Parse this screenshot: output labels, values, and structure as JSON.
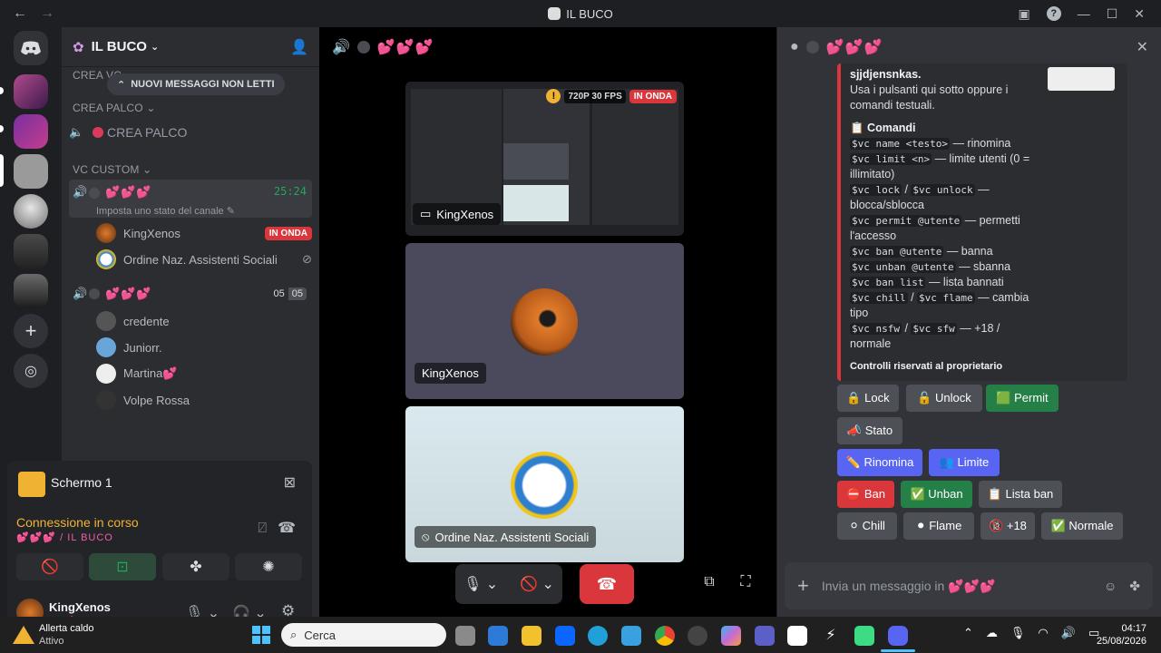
{
  "window": {
    "title": "IL BUCO"
  },
  "guild": {
    "name": "IL BUCO",
    "unread_pill": "NUOVI MESSAGGI NON LETTI",
    "cat_crea_vc": "CREA VC",
    "cat_crea_palco": "CREA PALCO",
    "crea_palco_channel": "CREA PALCO",
    "cat_vc_custom": "VC CUSTOM",
    "vc1": {
      "hearts": "💕💕💕",
      "timer": "25:24",
      "status_hint": "Imposta uno stato del canale"
    },
    "vc1_members": [
      {
        "name": "KingXenos",
        "badge": "IN ONDA"
      },
      {
        "name": "Ordine Naz. Assistenti Sociali"
      }
    ],
    "vc2": {
      "hearts": "💕💕💕",
      "count_a": "05",
      "count_b": "05"
    },
    "vc2_members": [
      {
        "name": "credente"
      },
      {
        "name": "Juniorr."
      },
      {
        "name": "Martina💕"
      },
      {
        "name": "Volpe Rossa"
      }
    ]
  },
  "voice_panel": {
    "screen_label": "Schermo 1",
    "connection": "Connessione in corso",
    "channel_path": "💕💕💕 / IL BUCO",
    "user": "KingXenos"
  },
  "stage": {
    "header_hearts": "💕💕💕",
    "stream_badge_fps": "720P 30 FPS",
    "stream_badge_live": "IN ONDA",
    "tile1_name": "KingXenos",
    "tile2_name": "KingXenos",
    "tile3_name": "Ordine Naz. Assistenti Sociali"
  },
  "chat": {
    "header_hearts": "💕💕💕",
    "embed": {
      "author_tail": "sjjdjensnkas.",
      "intro": "Usa i pulsanti qui sotto oppure i comandi testuali.",
      "section": "📋 Comandi",
      "lines": [
        {
          "code": "$vc name <testo>",
          "text": " — rinomina"
        },
        {
          "code": "$vc limit <n>",
          "text": " — limite utenti (0 = illimitato)"
        },
        {
          "code": "$vc lock",
          "code2": "$vc unlock",
          "text": " — blocca/sblocca"
        },
        {
          "code": "$vc permit @utente",
          "text": " — permetti l'accesso"
        },
        {
          "code": "$vc ban @utente",
          "text": " — banna"
        },
        {
          "code": "$vc unban @utente",
          "text": " — sbanna"
        },
        {
          "code": "$vc ban list",
          "text": " — lista bannati"
        },
        {
          "code": "$vc chill",
          "code2": "$vc flame",
          "text": " — cambia tipo"
        },
        {
          "code": "$vc nsfw",
          "code2": "$vc sfw",
          "text": " — +18 / normale"
        }
      ],
      "footer": "Controlli riservati al proprietario"
    },
    "buttons": {
      "lock": "🔒 Lock",
      "unlock": "🔓 Unlock",
      "permit": "🟩 Permit",
      "stato": "📣 Stato",
      "rinomina": "✏️ Rinomina",
      "limite": "👥 Limite",
      "ban": "⛔ Ban",
      "unban": "✅ Unban",
      "listaban": "📋 Lista ban",
      "chill": "⚪ Chill",
      "flame": "⚫ Flame",
      "plus18": "🔞 +18",
      "normale": "✅ Normale"
    },
    "composer_placeholder": "Invia un messaggio in 💕💕💕"
  },
  "taskbar": {
    "weather_title": "Allerta caldo",
    "weather_sub": "Attivo",
    "search": "Cerca",
    "time": "04:17",
    "date": "25/08/2026"
  },
  "colors": {
    "accent": "#5865f2",
    "danger": "#da373c",
    "success": "#248046",
    "live": "#da373c"
  }
}
